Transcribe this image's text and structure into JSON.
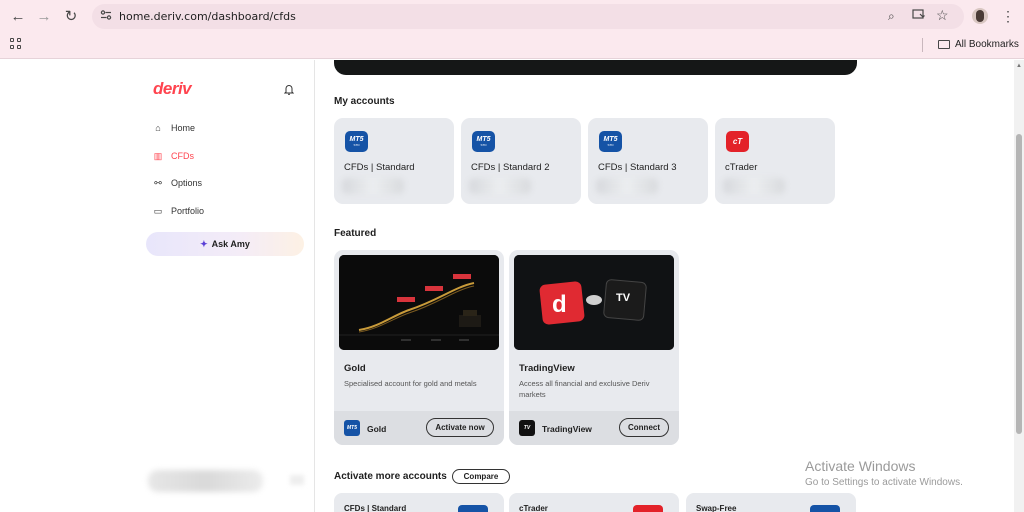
{
  "browser": {
    "url": "home.deriv.com/dashboard/cfds",
    "back_icon": "←",
    "forward_icon": "→",
    "reload_icon": "↻",
    "zoom_icon": "⌕",
    "star_icon": "☆",
    "menu_icon": "⋮",
    "all_bookmarks": "All Bookmarks"
  },
  "sidebar": {
    "logo": "deriv",
    "items": [
      {
        "label": "Home",
        "icon": "⌂"
      },
      {
        "label": "CFDs",
        "icon": "▥"
      },
      {
        "label": "Options",
        "icon": "⚯"
      },
      {
        "label": "Portfolio",
        "icon": "▭"
      }
    ],
    "ask_amy": "Ask Amy",
    "ask_amy_icon": "✦"
  },
  "accounts": {
    "title": "My accounts",
    "items": [
      {
        "name": "CFDs | Standard",
        "logo": "MT5",
        "logo_sub": "STD"
      },
      {
        "name": "CFDs | Standard 2",
        "logo": "MT5",
        "logo_sub": "STD"
      },
      {
        "name": "CFDs | Standard 3",
        "logo": "MT5",
        "logo_sub": "STD"
      },
      {
        "name": "cTrader",
        "logo": "cT",
        "logo_sub": ""
      }
    ]
  },
  "featured": {
    "title": "Featured",
    "items": [
      {
        "title": "Gold",
        "desc": "Specialised account for gold and metals",
        "footer_name": "Gold",
        "footer_logo": "MT5",
        "button": "Activate now"
      },
      {
        "title": "TradingView",
        "desc": "Access all financial and exclusive Deriv markets",
        "footer_name": "TradingView",
        "footer_logo": "TV",
        "button": "Connect"
      }
    ]
  },
  "more": {
    "title": "Activate more accounts",
    "compare": "Compare",
    "items": [
      {
        "name": "CFDs | Standard"
      },
      {
        "name": "cTrader"
      },
      {
        "name": "Swap-Free"
      }
    ]
  },
  "watermark": {
    "line1": "Activate Windows",
    "line2": "Go to Settings to activate Windows."
  }
}
